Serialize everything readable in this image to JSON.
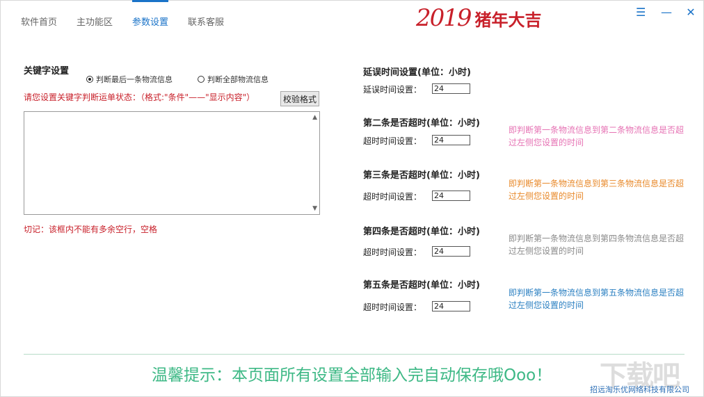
{
  "nav": {
    "items": [
      {
        "label": "软件首页",
        "active": false
      },
      {
        "label": "主功能区",
        "active": false
      },
      {
        "label": "参数设置",
        "active": true
      },
      {
        "label": "联系客服",
        "active": false
      }
    ]
  },
  "banner": {
    "year_text": "2019",
    "text": "猪年大吉"
  },
  "window_controls": {
    "menu": "☰",
    "minimize": "—",
    "close": "✕"
  },
  "keyword": {
    "title": "关键字设置",
    "radio_last": "判断最后一条物流信息",
    "radio_all": "判断全部物流信息",
    "hint": "请您设置关键字判断运单状态：（格式:\"条件\"——\"显示内容\"）",
    "verify_button": "校验格式",
    "textarea_value": "",
    "warning": "切记：该框内不能有多余空行，空格"
  },
  "delay": {
    "title": "延误时间设置(单位：小时)",
    "label": "延误时间设置：",
    "value": "24"
  },
  "timeouts": [
    {
      "title": "第二条是否超时(单位：小时)",
      "label": "超时时间设置：",
      "value": "24",
      "desc": "即判断第一条物流信息到第二条物流信息是否超过左侧您设置的时间",
      "color": "#e673b4"
    },
    {
      "title": "第三条是否超时(单位：小时)",
      "label": "超时时间设置：",
      "value": "24",
      "desc": "即判断第一条物流信息到第三条物流信息是否超过左侧您设置的时间",
      "color": "#e8892a"
    },
    {
      "title": "第四条是否超时(单位：小时)",
      "label": "超时时间设置：",
      "value": "24",
      "desc": "即判断第一条物流信息到第四条物流信息是否超过左侧您设置的时间",
      "color": "#8a8a8a"
    },
    {
      "title": "第五条是否超时(单位：小时)",
      "label": "超时时间设置：",
      "value": "24",
      "desc": "即判断第一条物流信息到第五条物流信息是否超过左侧您设置的时间",
      "color": "#2a7fc1"
    }
  ],
  "footer": {
    "tip": "温馨提示：本页面所有设置全部输入完自动保存哦Ooo！",
    "company": "招远淘乐优网络科技有限公司",
    "watermark": "下载吧"
  },
  "colors": {
    "accent": "#1a73c8",
    "warning": "#c8202a",
    "tip": "#3db885"
  }
}
